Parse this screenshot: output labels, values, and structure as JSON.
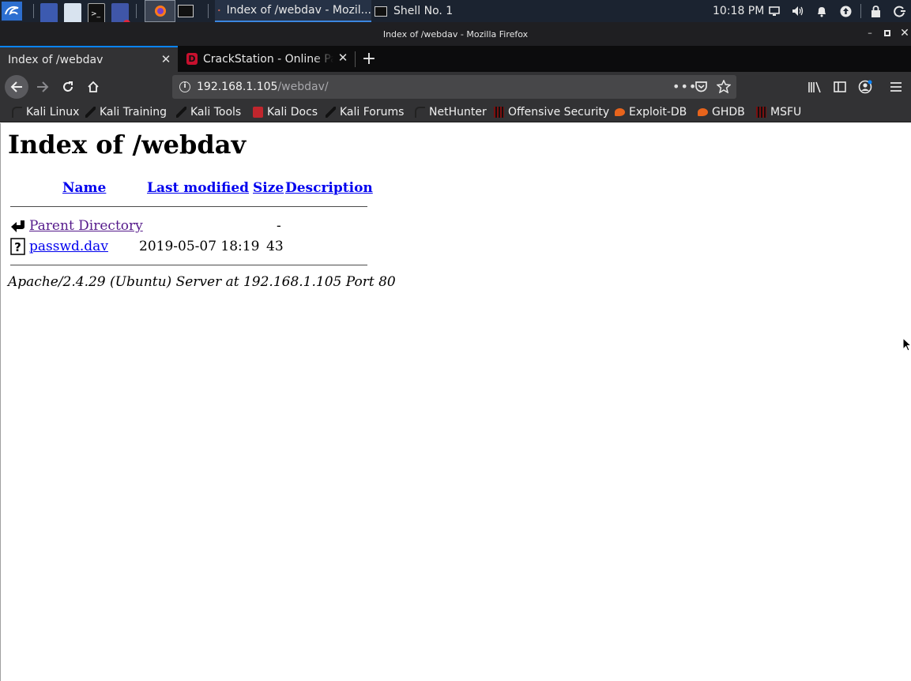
{
  "taskbar": {
    "tasks": [
      {
        "label": "Index of /webdav - Mozil...",
        "icon": "firefox-icon"
      },
      {
        "label": "Shell No. 1",
        "icon": "terminal-icon"
      }
    ],
    "clock": "10:18 PM"
  },
  "window": {
    "title": "Index of /webdav - Mozilla Firefox"
  },
  "tabs": [
    {
      "label": "Index of /webdav",
      "active": true
    },
    {
      "label": "CrackStation - Online Pa",
      "active": false
    }
  ],
  "urlbar": {
    "host": "192.168.1.105",
    "path": "/webdav/"
  },
  "bookmarks": [
    {
      "label": "Kali Linux",
      "icon": "kali-icon"
    },
    {
      "label": "Kali Training",
      "icon": "kali-dragon-icon"
    },
    {
      "label": "Kali Tools",
      "icon": "kali-dragon-icon"
    },
    {
      "label": "Kali Docs",
      "icon": "docs-icon"
    },
    {
      "label": "Kali Forums",
      "icon": "kali-dragon-icon"
    },
    {
      "label": "NetHunter",
      "icon": "kali-icon"
    },
    {
      "label": "Offensive Security",
      "icon": "offsec-icon"
    },
    {
      "label": "Exploit-DB",
      "icon": "exploitdb-icon"
    },
    {
      "label": "GHDB",
      "icon": "exploitdb-icon"
    },
    {
      "label": "MSFU",
      "icon": "offsec-icon"
    }
  ],
  "page": {
    "heading": "Index of /webdav",
    "columns": {
      "name": "Name",
      "last_modified": "Last modified",
      "size": "Size",
      "description": "Description"
    },
    "rows": [
      {
        "name": "Parent Directory",
        "last_modified": "",
        "size": "-",
        "description": "",
        "icon": "back-arrow-icon"
      },
      {
        "name": "passwd.dav",
        "last_modified": "2019-05-07 18:19",
        "size": "43",
        "description": "",
        "icon": "unknown-file-icon"
      }
    ],
    "footer": "Apache/2.4.29 (Ubuntu) Server at 192.168.1.105 Port 80"
  },
  "colors": {
    "link": "#0000ee",
    "visited_link": "#551a8b",
    "tab_accent": "#0a84ff"
  }
}
